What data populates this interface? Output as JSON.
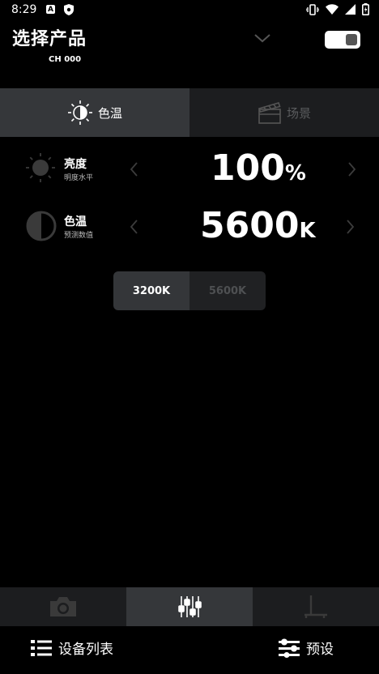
{
  "status": {
    "time": "8:29",
    "icons": [
      "a-notification-icon",
      "shield-icon",
      "vibrate-icon",
      "wifi-icon",
      "signal-icon",
      "battery-icon"
    ]
  },
  "header": {
    "title": "选择产品",
    "subtitle": "CH 000",
    "power_on": true
  },
  "mode_tabs": [
    {
      "label": "色温",
      "icon": "color-temperature-icon",
      "active": true
    },
    {
      "label": "场景",
      "icon": "clapperboard-icon",
      "active": false
    }
  ],
  "controls": {
    "brightness": {
      "label": "亮度",
      "sublabel": "明度水平",
      "value": "100",
      "unit": "%"
    },
    "cct": {
      "label": "色温",
      "sublabel": "预测数值",
      "value": "5600",
      "unit": "K"
    }
  },
  "presets": [
    {
      "label": "3200K",
      "active": true
    },
    {
      "label": "5600K",
      "active": false
    }
  ],
  "bottom_tabs": [
    {
      "icon": "camera-icon",
      "active": false
    },
    {
      "icon": "sliders-icon",
      "active": true
    },
    {
      "icon": "stand-icon",
      "active": false
    }
  ],
  "bottom_bar": {
    "device_list": "设备列表",
    "presets": "预设"
  },
  "colors": {
    "background": "#000000",
    "tab_active": "#35373a",
    "tab_inactive": "#1c1d1f"
  }
}
